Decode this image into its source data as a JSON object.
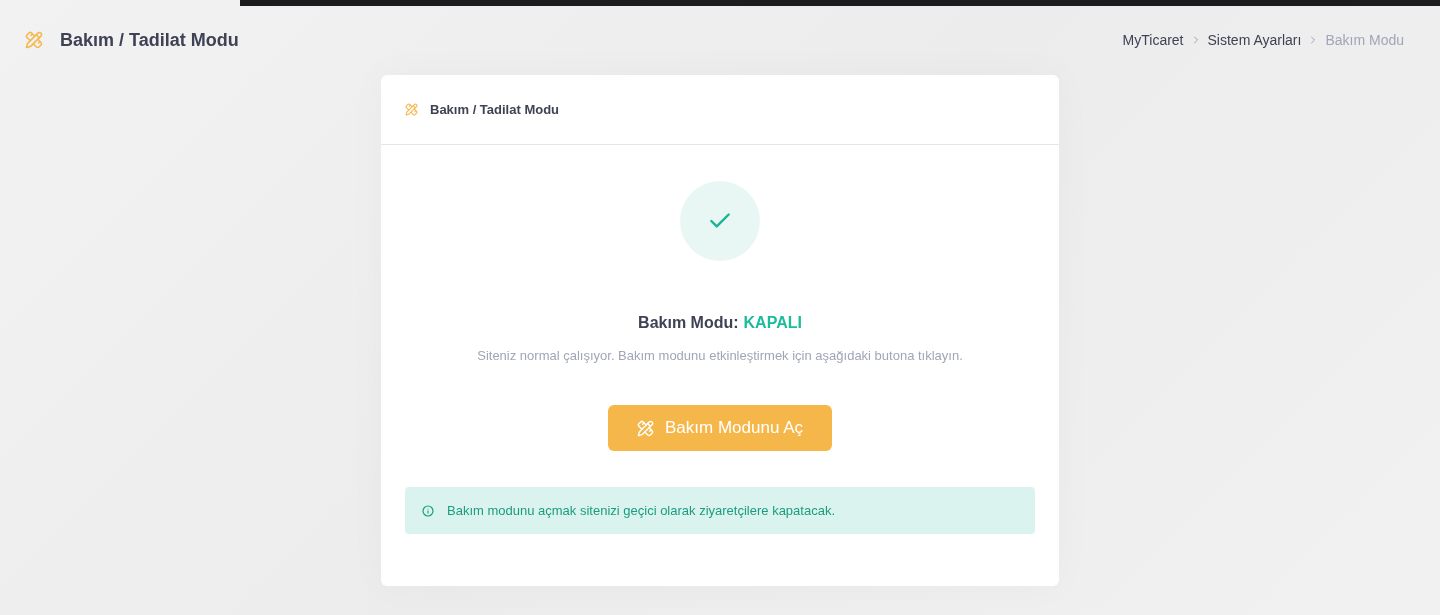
{
  "page": {
    "title": "Bakım / Tadilat Modu"
  },
  "breadcrumb": [
    {
      "label": "MyTicaret",
      "current": false
    },
    {
      "label": "Sistem Ayarları",
      "current": false
    },
    {
      "label": "Bakım Modu",
      "current": true
    }
  ],
  "card": {
    "title": "Bakım / Tadilat Modu",
    "status": {
      "label": "Bakım Modu:",
      "value": "KAPALI",
      "on": false
    },
    "description": "Siteniz normal çalışıyor. Bakım modunu etkinleştirmek için aşağıdaki butona tıklayın.",
    "button": {
      "label": "Bakım Modunu Aç"
    },
    "alert": {
      "text": "Bakım modunu açmak sitenizi geçici olarak ziyaretçilere kapatacak."
    }
  }
}
